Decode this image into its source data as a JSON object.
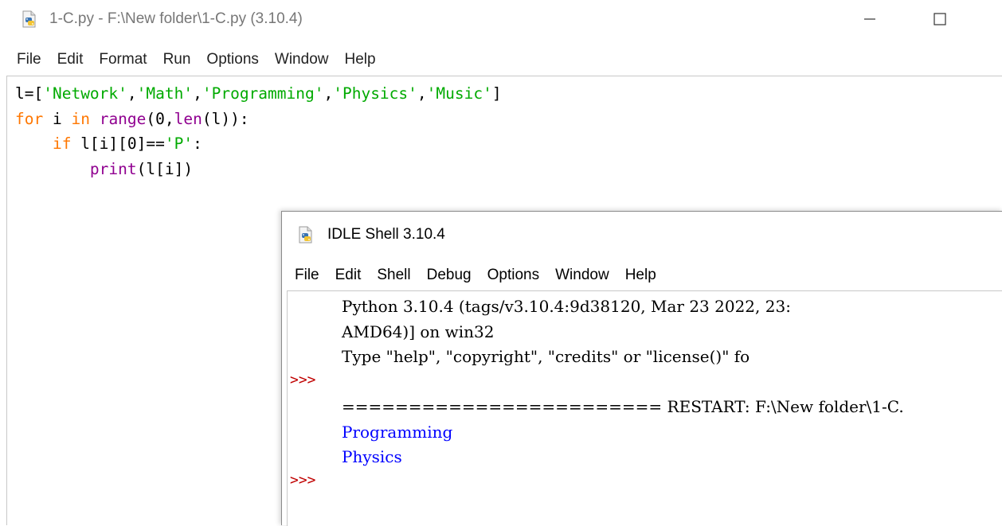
{
  "editor": {
    "title": "1-C.py - F:\\New folder\\1-C.py (3.10.4)",
    "menu": [
      "File",
      "Edit",
      "Format",
      "Run",
      "Options",
      "Window",
      "Help"
    ],
    "icon": "python-file-icon",
    "code": {
      "line1": {
        "prefix": "l=[",
        "s1": "'Network'",
        "c1": ",",
        "s2": "'Math'",
        "c2": ",",
        "s3": "'Programming'",
        "c3": ",",
        "s4": "'Physics'",
        "c4": ",",
        "s5": "'Music'",
        "suffix": "]"
      },
      "line2": {
        "kw_for": "for",
        "sp1": " i ",
        "kw_in": "in",
        "sp2": " ",
        "bi_range": "range",
        "mid": "(0,",
        "bi_len": "len",
        "end": "(l)):"
      },
      "line3": {
        "indent": "    ",
        "kw_if": "if",
        "mid": " l[i][0]==",
        "str": "'P'",
        "end": ":"
      },
      "line4": {
        "indent": "        ",
        "bi_print": "print",
        "end": "(l[i])"
      }
    }
  },
  "shell": {
    "title": "IDLE Shell 3.10.4",
    "menu": [
      "File",
      "Edit",
      "Shell",
      "Debug",
      "Options",
      "Window",
      "Help"
    ],
    "prompts": [
      ">>>",
      ">>>"
    ],
    "lines": {
      "banner1": "Python 3.10.4 (tags/v3.10.4:9d38120, Mar 23 2022, 23:",
      "banner2": "AMD64)] on win32",
      "banner3": "Type \"help\", \"copyright\", \"credits\" or \"license()\" fo",
      "restart": "======================== RESTART: F:\\New folder\\1-C.",
      "out1": "Programming",
      "out2": "Physics"
    }
  },
  "colors": {
    "keyword": "#ff7700",
    "builtin": "#900090",
    "string": "#00aa00",
    "output": "#0000ff",
    "prompt": "#c00000"
  }
}
